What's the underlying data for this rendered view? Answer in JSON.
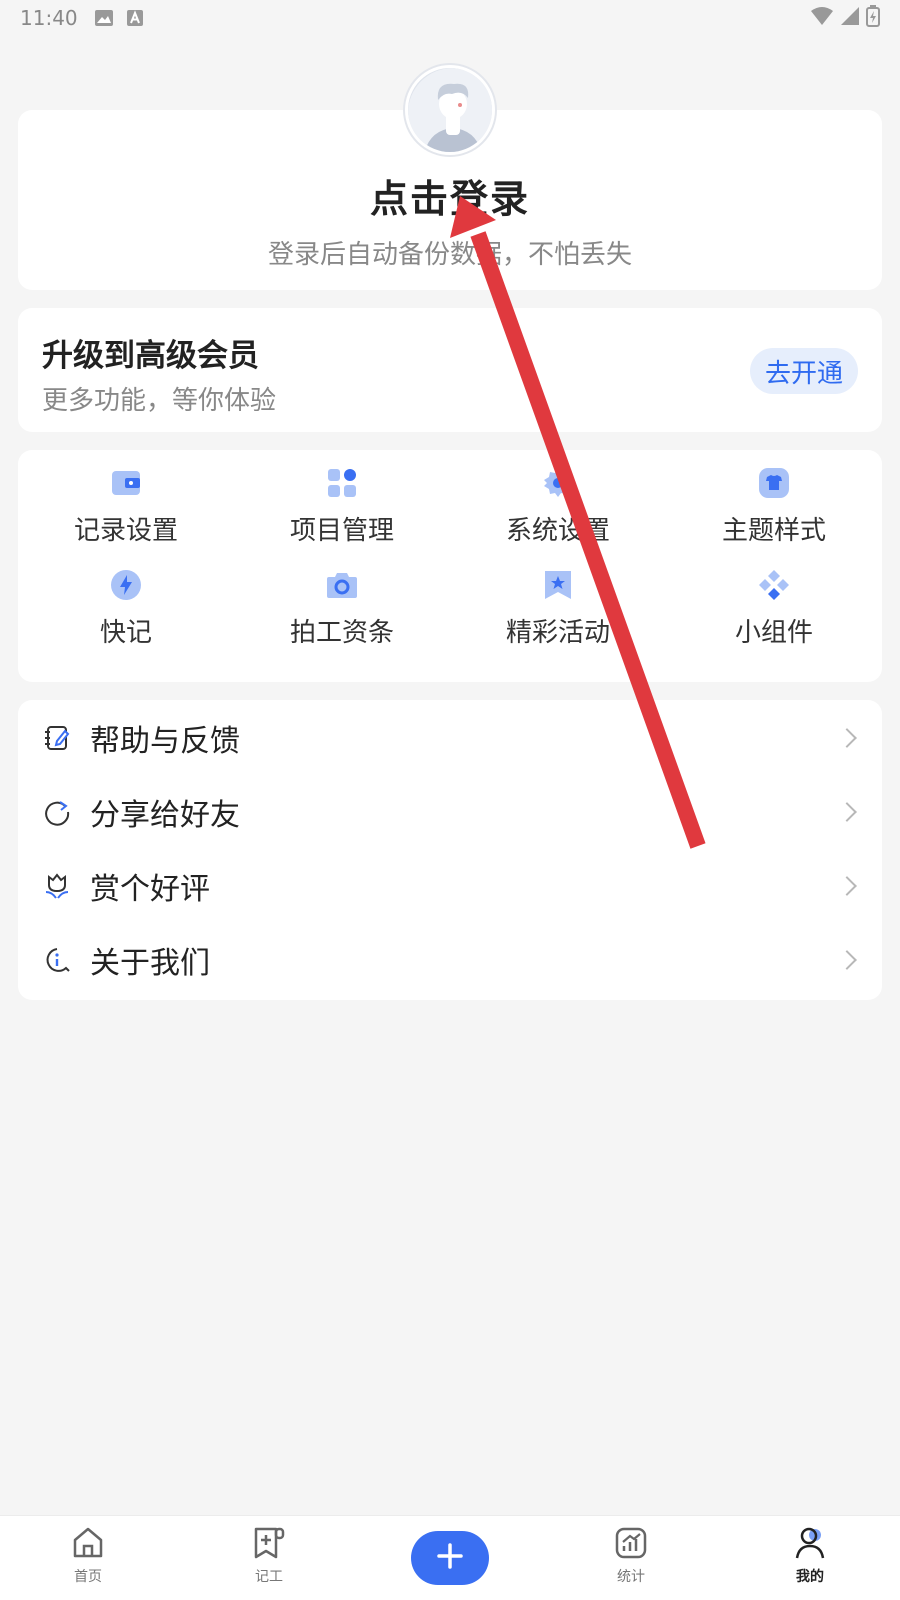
{
  "status_bar": {
    "time": "11:40"
  },
  "profile": {
    "login_title": "点击登录",
    "login_subtitle": "登录后自动备份数据，不怕丢失"
  },
  "vip": {
    "title": "升级到高级会员",
    "subtitle": "更多功能，等你体验",
    "button": "去开通"
  },
  "grid": {
    "items": [
      {
        "label": "记录设置",
        "icon": "wallet-icon"
      },
      {
        "label": "项目管理",
        "icon": "apps-icon"
      },
      {
        "label": "系统设置",
        "icon": "gear-icon"
      },
      {
        "label": "主题样式",
        "icon": "shirt-icon"
      },
      {
        "label": "快记",
        "icon": "lightning-icon"
      },
      {
        "label": "拍工资条",
        "icon": "camera-icon"
      },
      {
        "label": "精彩活动",
        "icon": "star-bookmark-icon"
      },
      {
        "label": "小组件",
        "icon": "widget-icon"
      }
    ]
  },
  "menu": {
    "items": [
      {
        "label": "帮助与反馈",
        "icon": "notebook-edit-icon"
      },
      {
        "label": "分享给好友",
        "icon": "share-refresh-icon"
      },
      {
        "label": "赏个好评",
        "icon": "flower-icon"
      },
      {
        "label": "关于我们",
        "icon": "info-icon"
      }
    ]
  },
  "bottom_nav": {
    "items": [
      {
        "label": "首页",
        "icon": "home-icon"
      },
      {
        "label": "记工",
        "icon": "record-icon"
      },
      {
        "label": "",
        "icon": "plus-icon"
      },
      {
        "label": "统计",
        "icon": "chart-icon"
      },
      {
        "label": "我的",
        "icon": "person-icon"
      }
    ],
    "active_index": 4
  },
  "colors": {
    "accent": "#2f6bf0",
    "background": "#f5f5f5",
    "annotation_arrow": "#e0393e"
  }
}
